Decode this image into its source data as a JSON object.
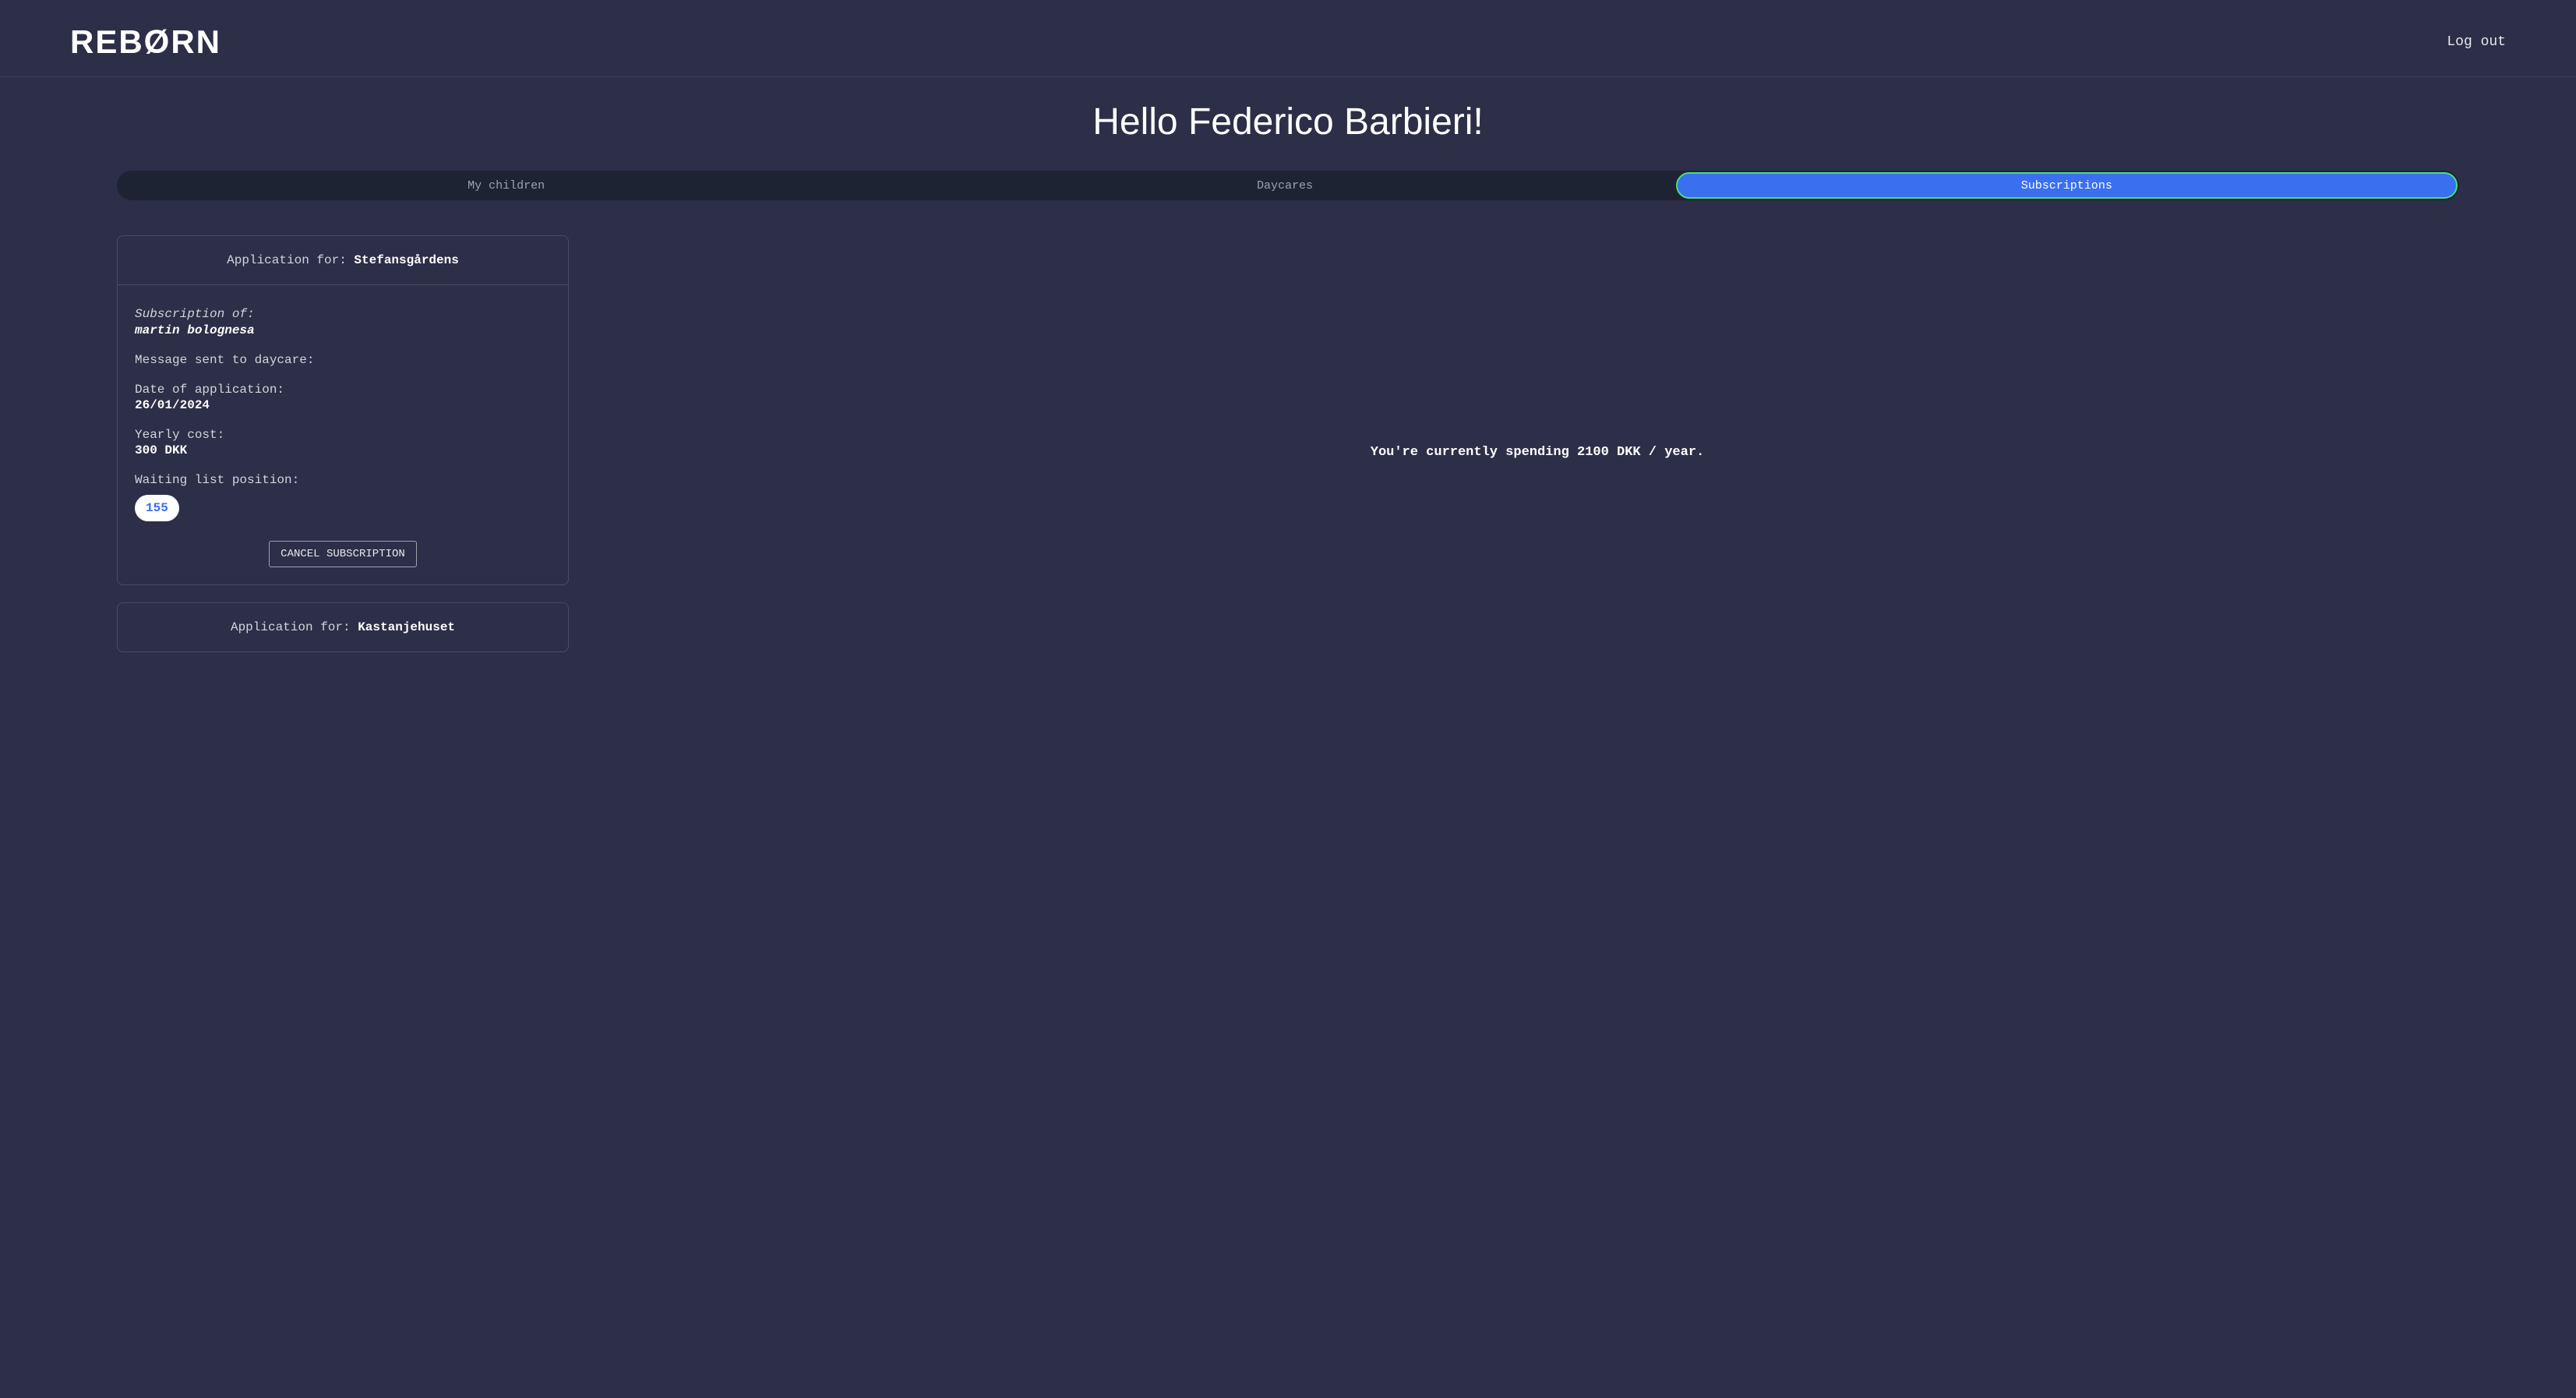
{
  "header": {
    "logo": "REBØRN",
    "logout": "Log out"
  },
  "greeting": "Hello Federico Barbieri!",
  "tabs": {
    "my_children": "My children",
    "daycares": "Daycares",
    "subscriptions": "Subscriptions"
  },
  "cards": [
    {
      "header_prefix": "Application for: ",
      "header_value": "Stefansgårdens",
      "subscription_of_label": "Subscription of:",
      "subscription_name": "martin bolognesa",
      "message_label": "Message sent to daycare:",
      "date_label": "Date of application:",
      "date_value": "26/01/2024",
      "cost_label": "Yearly cost:",
      "cost_value": "300 DKK",
      "position_label": "Waiting list position:",
      "position_value": "155",
      "cancel_button": "CANCEL SUBSCRIPTION"
    },
    {
      "header_prefix": "Application for: ",
      "header_value": "Kastanjehuset"
    }
  ],
  "spending": "You're currently spending 2100 DKK / year."
}
